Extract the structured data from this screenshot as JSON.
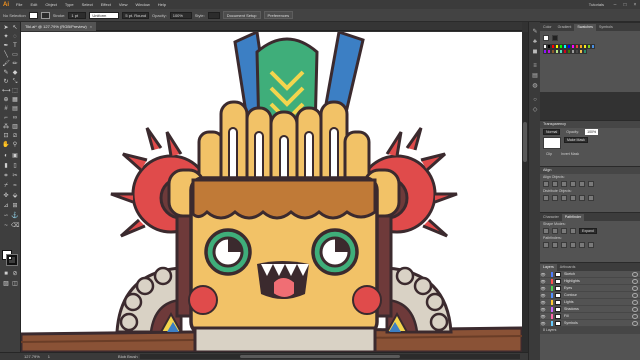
{
  "app": {
    "logo": "Ai",
    "menu": [
      "File",
      "Edit",
      "Object",
      "Type",
      "Select",
      "Effect",
      "View",
      "Window",
      "Help"
    ],
    "workspace": "Tutorials",
    "window_buttons": [
      "–",
      "□",
      "×"
    ]
  },
  "control_bar": {
    "selection_label": "No Selection",
    "stroke_label": "Stroke:",
    "stroke_value": "1 pt",
    "profile_value": "Uniform",
    "brush_value": "5 pt. Round",
    "opacity_label": "Opacity:",
    "opacity_value": "100%",
    "style_label": "Style:",
    "document_setup_label": "Document Setup",
    "preferences_label": "Preferences"
  },
  "document": {
    "tab_title": "Tiki.ai* @ 127.79% (RGB/Preview)",
    "close": "×"
  },
  "statusbar": {
    "zoom": "127.79%",
    "page": "1",
    "tool_name": "Blob Brush"
  },
  "panels": {
    "top_tabs": [
      "Color",
      "Gradient",
      "Swatches",
      "Symbols"
    ],
    "transparency": {
      "title": "Transparency",
      "blend_mode": "Normal",
      "opacity_label": "Opacity:",
      "opacity_value": "100%",
      "make_mask_label": "Make Mask",
      "clip_label": "Clip",
      "invert_label": "Invert Mask"
    },
    "align": {
      "title": "Align",
      "align_objects_label": "Align Objects:",
      "distribute_objects_label": "Distribute Objects:",
      "distribute_spacing_label": "Distribute Spacing:",
      "align_to_label": "Align To:"
    },
    "pathfinder": {
      "tabs": [
        "Character",
        "Pathfinder"
      ],
      "shape_modes_label": "Shape Modes:",
      "expand_label": "Expand",
      "pathfinders_label": "Pathfinders:"
    },
    "layers": {
      "tabs": [
        "Layers",
        "Artboards"
      ],
      "rows": [
        {
          "name": "Sketch",
          "color": "#4f7cff"
        },
        {
          "name": "Highlights",
          "color": "#ff4f4f"
        },
        {
          "name": "Eyes",
          "color": "#4fd14f"
        },
        {
          "name": "Contour",
          "color": "#4f8fff"
        },
        {
          "name": "Lights",
          "color": "#ffcc33"
        },
        {
          "name": "Shadows",
          "color": "#cc66ff"
        },
        {
          "name": "Fill",
          "color": "#ff66aa"
        },
        {
          "name": "Symbols",
          "color": "#66ccff"
        }
      ],
      "footer": "8 Layers"
    }
  },
  "swatch_colors": [
    "#ffffff",
    "#000000",
    "#ff0000",
    "#ffff00",
    "#00ff00",
    "#00ffff",
    "#0000ff",
    "#ff00ff",
    "#e8463a",
    "#f5a623",
    "#f8e71c",
    "#7ed321",
    "#4a90e2",
    "#9013fe",
    "#bd10e0",
    "#8b572a",
    "#b8e986",
    "#50e3c2",
    "#d0021b",
    "#417505",
    "#9b9b9b",
    "#4a4a4a",
    "#f2c14e",
    "#2d8c6b"
  ],
  "icons": {
    "tools": [
      "selection-icon",
      "direct-selection-icon",
      "magic-wand-icon",
      "lasso-icon",
      "pen-icon",
      "type-icon",
      "line-icon",
      "rectangle-icon",
      "paintbrush-icon",
      "pencil-icon",
      "blob-brush-icon",
      "eraser-icon",
      "rotate-icon",
      "scale-icon",
      "width-icon",
      "free-transform-icon",
      "shape-builder-icon",
      "perspective-icon",
      "mesh-icon",
      "gradient-icon",
      "eyedropper-icon",
      "blend-icon",
      "symbol-sprayer-icon",
      "graph-icon",
      "artboard-icon",
      "slice-icon",
      "hand-icon",
      "zoom-icon"
    ]
  },
  "artwork": {
    "title": "Tiki mask illustration",
    "colors": {
      "outline": "#3b2a2e",
      "wood": "#f2c267",
      "wood_dark": "#d99a4a",
      "wood_shadow": "#c07a37",
      "feather_blue": "#3c7fc4",
      "feather_green": "#3fae7a",
      "feather_yellow": "#f3d54e",
      "flower_red": "#e04b4b",
      "eye_green": "#3fae7a",
      "cheek": "#e04b4b",
      "tongue": "#f06e74",
      "stone": "#d9d2c5",
      "ground": "#7a4730"
    }
  }
}
